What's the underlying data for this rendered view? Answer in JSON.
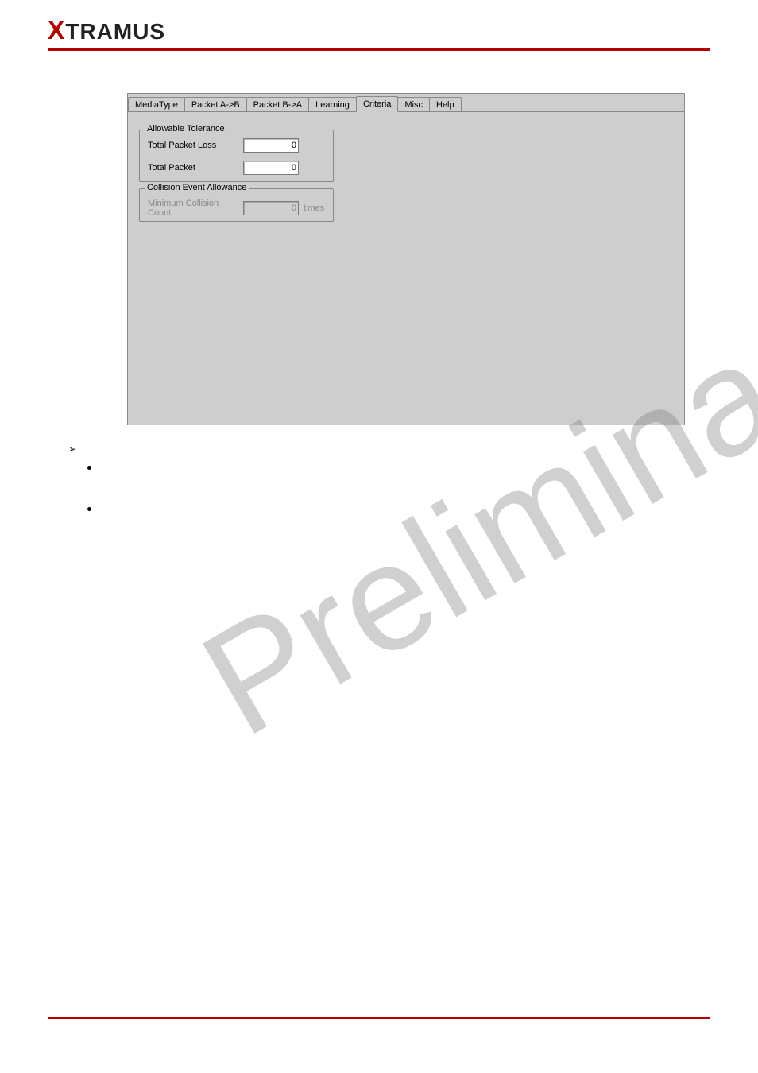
{
  "logo": {
    "x": "X",
    "rest": "TRAMUS"
  },
  "tabs": {
    "mediatype": "MediaType",
    "packet_ab": "Packet A->B",
    "packet_ba": "Packet B->A",
    "learning": "Learning",
    "criteria": "Criteria",
    "misc": "Misc",
    "help": "Help"
  },
  "group1": {
    "legend": "Allowable Tolerance",
    "total_packet_loss_label": "Total Packet Loss",
    "total_packet_loss_value": "0",
    "total_packet_label": "Total Packet",
    "total_packet_value": "0"
  },
  "group2": {
    "legend": "Collision Event Allowance",
    "min_collision_label": "Minimum Collision Count",
    "min_collision_value": "0",
    "unit": "times"
  },
  "watermark": "Preliminary"
}
